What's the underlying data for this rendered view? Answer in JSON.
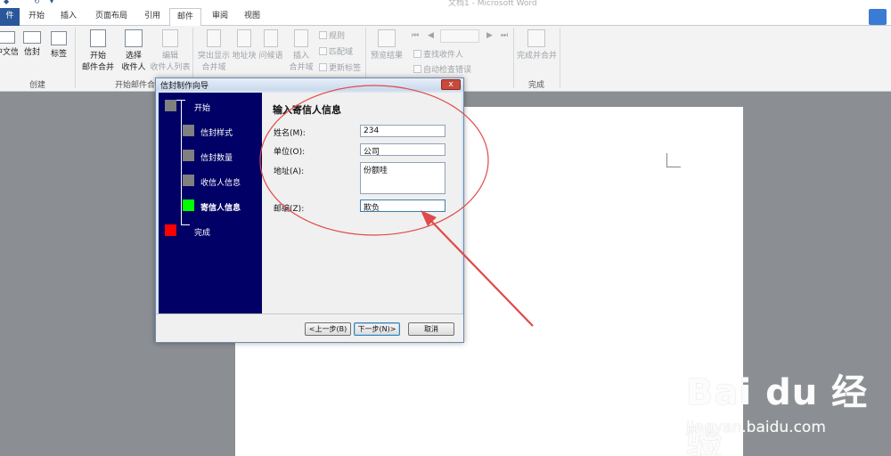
{
  "window": {
    "title": "文档1 - Microsoft Word"
  },
  "tabs": [
    "件",
    "开始",
    "插入",
    "页面布局",
    "引用",
    "邮件",
    "审阅",
    "视图"
  ],
  "ribbon": {
    "create": {
      "envelope": "中文信封",
      "envelope2": "信封",
      "labels": "标签",
      "group": "创建"
    },
    "start": {
      "start_line1": "开始",
      "start_line2": "邮件合并",
      "select_line1": "选择",
      "select_line2": "收件人",
      "edit_line1": "编辑",
      "edit_line2": "收件人列表",
      "group": "开始邮件合并"
    },
    "fields": {
      "highlight_line1": "突出显示",
      "highlight_line2": "合并域",
      "address_block": "地址块",
      "greeting": "问候语",
      "insert_line1": "插入",
      "insert_line2": "合并域",
      "rules": "规则",
      "match_fields": "匹配域",
      "update_labels": "更新标签"
    },
    "preview": {
      "preview_results": "预览结果",
      "find_recipient": "查找收件人",
      "auto_check": "自动检查错误"
    },
    "finish": {
      "finish_merge": "完成并合并",
      "group": "完成"
    }
  },
  "dialog": {
    "title": "信封制作向导",
    "close": "x",
    "steps": [
      {
        "label": "开始",
        "state": "done"
      },
      {
        "label": "信封样式",
        "state": "done"
      },
      {
        "label": "信封数量",
        "state": "done"
      },
      {
        "label": "收信人信息",
        "state": "done"
      },
      {
        "label": "寄信人信息",
        "state": "current"
      },
      {
        "label": "完成",
        "state": "pending"
      }
    ],
    "heading": "输入寄信人信息",
    "fields": {
      "name": {
        "label": "姓名(M):",
        "value": "234"
      },
      "company": {
        "label": "单位(O):",
        "value": "公司"
      },
      "address": {
        "label": "地址(A):",
        "value": "份额哇"
      },
      "postcode": {
        "label": "邮编(Z):",
        "value": "欺负"
      }
    },
    "buttons": {
      "back": "<上一步(B)",
      "next": "下一步(N)>",
      "cancel": "取消"
    }
  },
  "colors": {
    "nav_bg": "#000066",
    "step_done": "#808080",
    "step_current": "#00ff00",
    "step_finish": "#ff0000",
    "annotation": "#e04a4a"
  },
  "watermark": {
    "logo": "Bai du 经验",
    "site": "jingyan.baidu.com"
  }
}
